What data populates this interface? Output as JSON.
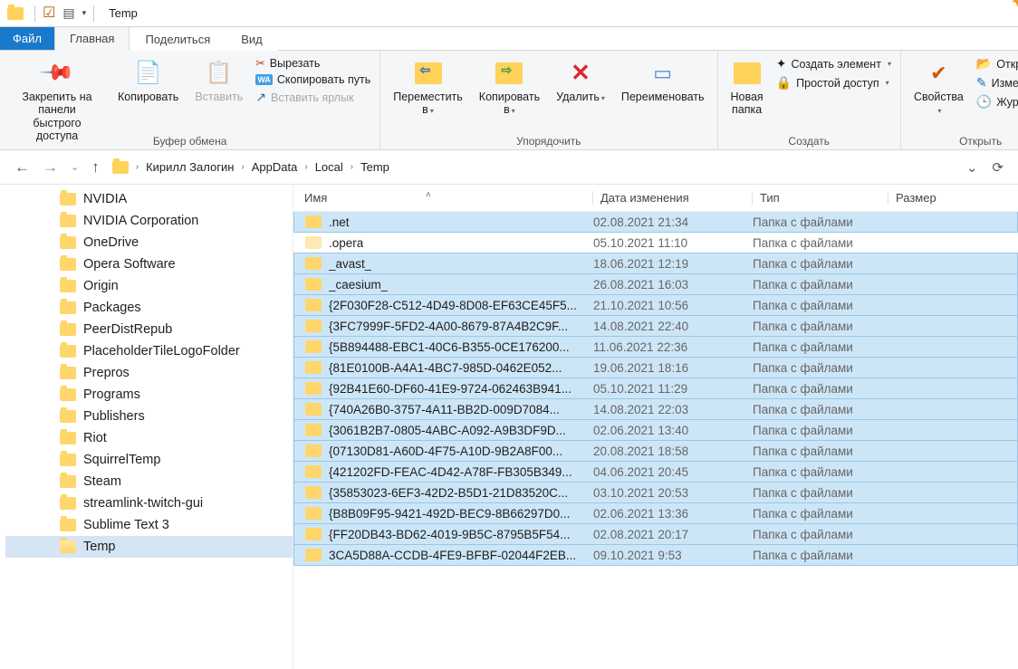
{
  "title": "Temp",
  "tabs": {
    "file": "Файл",
    "home": "Главная",
    "share": "Поделиться",
    "view": "Вид"
  },
  "ribbon": {
    "pin": "Закрепить на панели\nбыстрого доступа",
    "copy": "Копировать",
    "paste": "Вставить",
    "cut": "Вырезать",
    "copypath": "Скопировать путь",
    "pastelink": "Вставить ярлык",
    "clipboard": "Буфер обмена",
    "moveto": "Переместить в",
    "copyto": "Копировать в",
    "delete": "Удалить",
    "rename": "Переименовать",
    "organize": "Упорядочить",
    "newfolder": "Новая папка",
    "newitem": "Создать элемент",
    "easyaccess": "Простой доступ",
    "new": "Создать",
    "properties": "Свойства",
    "open": "Открыть",
    "edit": "Изменить",
    "history": "Журнал",
    "openg": "Открыть"
  },
  "breadcrumb": [
    "Кирилл Залогин",
    "AppData",
    "Local",
    "Temp"
  ],
  "columns": {
    "name": "Имя",
    "date": "Дата изменения",
    "type": "Тип",
    "size": "Размер"
  },
  "tree": [
    "NVIDIA",
    "NVIDIA Corporation",
    "OneDrive",
    "Opera Software",
    "Origin",
    "Packages",
    "PeerDistRepub",
    "PlaceholderTileLogoFolder",
    "Prepros",
    "Programs",
    "Publishers",
    "Riot",
    "SquirrelTemp",
    "Steam",
    "streamlink-twitch-gui",
    "Sublime Text 3",
    "Temp"
  ],
  "files": [
    {
      "n": ".net",
      "d": "02.08.2021 21:34",
      "t": "Папка с файлами"
    },
    {
      "n": ".opera",
      "d": "05.10.2021 11:10",
      "t": "Папка с файлами"
    },
    {
      "n": "_avast_",
      "d": "18.06.2021 12:19",
      "t": "Папка с файлами"
    },
    {
      "n": "_caesium_",
      "d": "26.08.2021 16:03",
      "t": "Папка с файлами"
    },
    {
      "n": "{2F030F28-C512-4D49-8D08-EF63CE45F5...",
      "d": "21.10.2021 10:56",
      "t": "Папка с файлами"
    },
    {
      "n": "{3FC7999F-5FD2-4A00-8679-87A4B2C9F...",
      "d": "14.08.2021 22:40",
      "t": "Папка с файлами"
    },
    {
      "n": "{5B894488-EBC1-40C6-B355-0CE176200...",
      "d": "11.06.2021 22:36",
      "t": "Папка с файлами"
    },
    {
      "n": "{81E0100B-A4A1-4BC7-985D-0462E052...",
      "d": "19.06.2021 18:16",
      "t": "Папка с файлами"
    },
    {
      "n": "{92B41E60-DF60-41E9-9724-062463B941...",
      "d": "05.10.2021 11:29",
      "t": "Папка с файлами"
    },
    {
      "n": "{740A26B0-3757-4A11-BB2D-009D7084...",
      "d": "14.08.2021 22:03",
      "t": "Папка с файлами"
    },
    {
      "n": "{3061B2B7-0805-4ABC-A092-A9B3DF9D...",
      "d": "02.06.2021 13:40",
      "t": "Папка с файлами"
    },
    {
      "n": "{07130D81-A60D-4F75-A10D-9B2A8F00...",
      "d": "20.08.2021 18:58",
      "t": "Папка с файлами"
    },
    {
      "n": "{421202FD-FEAC-4D42-A78F-FB305B349...",
      "d": "04.06.2021 20:45",
      "t": "Папка с файлами"
    },
    {
      "n": "{35853023-6EF3-42D2-B5D1-21D83520C...",
      "d": "03.10.2021 20:53",
      "t": "Папка с файлами"
    },
    {
      "n": "{B8B09F95-9421-492D-BEC9-8B66297D0...",
      "d": "02.06.2021 13:36",
      "t": "Папка с файлами"
    },
    {
      "n": "{FF20DB43-BD62-4019-9B5C-8795B5F54...",
      "d": "02.08.2021 20:17",
      "t": "Папка с файлами"
    },
    {
      "n": "3CA5D88A-CCDB-4FE9-BFBF-02044F2EB...",
      "d": "09.10.2021 9:53",
      "t": "Папка с файлами"
    }
  ]
}
